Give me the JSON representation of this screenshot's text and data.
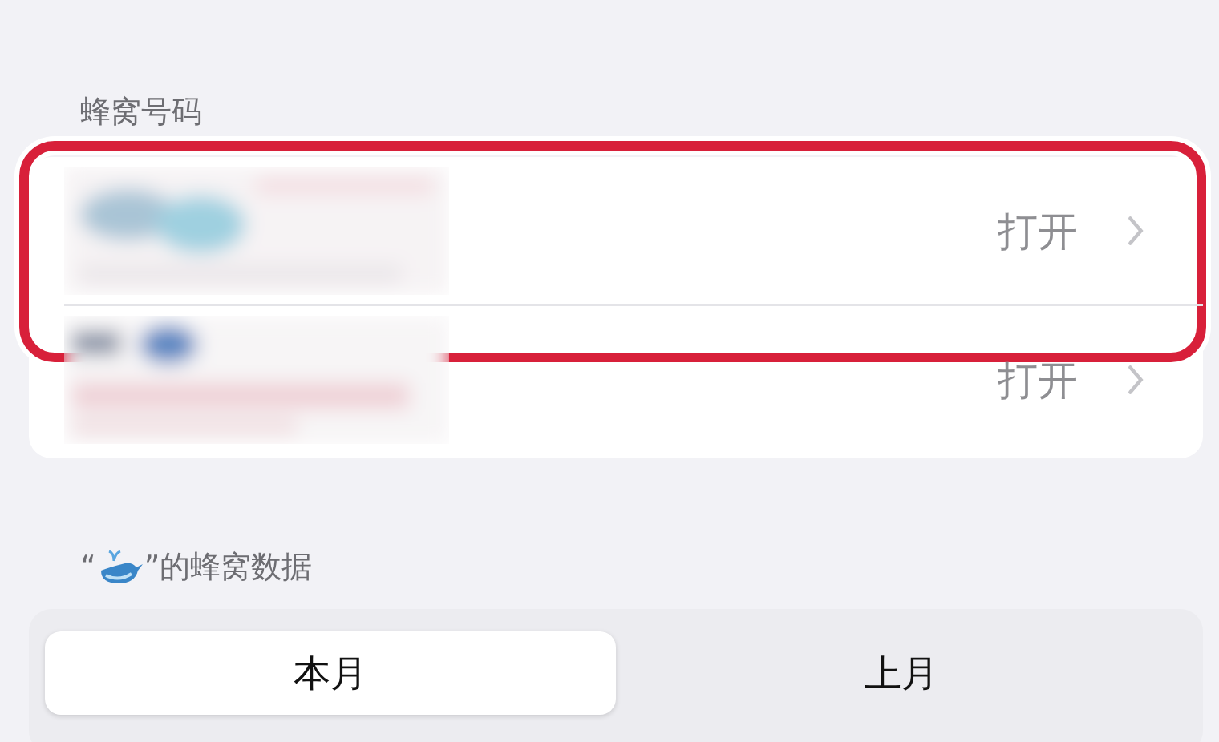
{
  "numbers_section": {
    "header": "蜂窝号码",
    "rows": [
      {
        "kind": "picture",
        "value": "打开",
        "highlighted": true
      },
      {
        "kind": "picture",
        "value": "打开",
        "highlighted": false
      }
    ]
  },
  "data_section": {
    "header_prefix": "“",
    "header_suffix": "”的蜂窝数据",
    "segments": [
      {
        "label": "本月",
        "selected": true
      },
      {
        "label": "上月",
        "selected": false
      }
    ]
  }
}
